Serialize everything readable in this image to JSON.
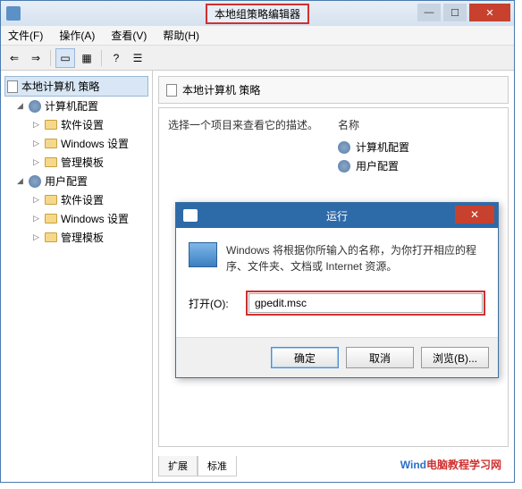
{
  "window": {
    "title": "本地组策略编辑器"
  },
  "menu": {
    "file": "文件(F)",
    "action": "操作(A)",
    "view": "查看(V)",
    "help": "帮助(H)"
  },
  "tree": {
    "root": "本地计算机 策略",
    "computer": "计算机配置",
    "user": "用户配置",
    "software": "软件设置",
    "windows": "Windows 设置",
    "admin": "管理模板"
  },
  "content": {
    "header": "本地计算机 策略",
    "desc": "选择一个项目来查看它的描述。",
    "col_name": "名称",
    "item_computer": "计算机配置",
    "item_user": "用户配置"
  },
  "tabs": {
    "extended": "扩展",
    "standard": "标准"
  },
  "run": {
    "title": "运行",
    "desc": "Windows 将根据你所输入的名称，为你打开相应的程序、文件夹、文档或 Internet 资源。",
    "label": "打开(O):",
    "value": "gpedit.msc",
    "ok": "确定",
    "cancel": "取消",
    "browse": "浏览(B)..."
  },
  "watermark": {
    "part1": "Wind",
    "part2": "电脑教程学习网"
  }
}
